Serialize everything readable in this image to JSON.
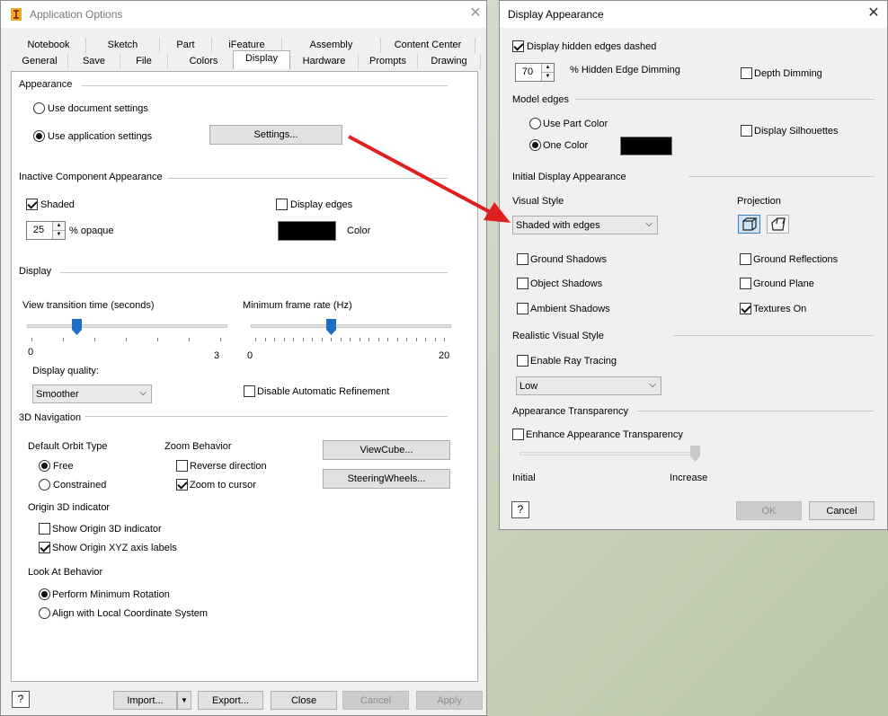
{
  "app_options": {
    "title": "Application Options",
    "tabs_row1": [
      "Notebook",
      "Sketch",
      "Part",
      "iFeature",
      "Assembly",
      "Content Center"
    ],
    "tabs_row2": [
      "General",
      "Save",
      "File",
      "Colors",
      "Display",
      "Hardware",
      "Prompts",
      "Drawing"
    ],
    "active_tab": "Display",
    "appearance": {
      "label": "Appearance",
      "use_document": "Use document settings",
      "use_application": "Use application settings",
      "settings_button": "Settings..."
    },
    "inactive": {
      "label": "Inactive Component Appearance",
      "shaded": "Shaded",
      "display_edges": "Display edges",
      "opaque_value": "25",
      "opaque_label": "% opaque",
      "color_label": "Color",
      "color_hex": "#000000"
    },
    "display": {
      "label": "Display",
      "transition_label": "View transition time (seconds)",
      "transition_min": "0",
      "transition_max": "3",
      "transition_value": 0.75,
      "frame_label": "Minimum frame rate (Hz)",
      "frame_min": "0",
      "frame_max": "20",
      "frame_value": 8,
      "quality_label": "Display quality:",
      "quality_value": "Smoother",
      "disable_refinement": "Disable Automatic Refinement"
    },
    "nav": {
      "label": "3D Navigation",
      "orbit_label": "Default Orbit Type",
      "orbit_free": "Free",
      "orbit_constrained": "Constrained",
      "zoom_label": "Zoom Behavior",
      "reverse_direction": "Reverse direction",
      "zoom_to_cursor": "Zoom to cursor",
      "viewcube_button": "ViewCube...",
      "steeringwheels_button": "SteeringWheels...",
      "origin_label": "Origin 3D indicator",
      "show_origin_3d": "Show Origin 3D indicator",
      "show_origin_xyz": "Show Origin XYZ axis labels",
      "lookat_label": "Look At Behavior",
      "perform_min_rotation": "Perform Minimum Rotation",
      "align_local": "Align with Local Coordinate System"
    },
    "footer": {
      "help": "?",
      "import": "Import...",
      "export": "Export...",
      "close": "Close",
      "cancel": "Cancel",
      "apply": "Apply"
    }
  },
  "display_appearance": {
    "title": "Display Appearance",
    "hidden_dashed": "Display hidden edges dashed",
    "dimming_value": "70",
    "dimming_label": "% Hidden Edge Dimming",
    "depth_dimming": "Depth Dimming",
    "model_edges_label": "Model edges",
    "use_part_color": "Use Part Color",
    "one_color": "One Color",
    "display_silhouettes": "Display Silhouettes",
    "edge_color_hex": "#000000",
    "initial_label": "Initial Display Appearance",
    "visual_style_label": "Visual Style",
    "visual_style_value": "Shaded with edges",
    "projection_label": "Projection",
    "ground_shadows": "Ground Shadows",
    "object_shadows": "Object Shadows",
    "ambient_shadows": "Ambient Shadows",
    "ground_reflections": "Ground Reflections",
    "ground_plane": "Ground Plane",
    "textures_on": "Textures On",
    "realistic_label": "Realistic Visual Style",
    "enable_ray_tracing": "Enable Ray Tracing",
    "ray_quality": "Low",
    "transparency_label": "Appearance Transparency",
    "enhance_transparency": "Enhance Appearance Transparency",
    "transparency_min": "Initial",
    "transparency_max": "Increase",
    "transparency_value": 1.0,
    "help": "?",
    "ok": "OK",
    "cancel": "Cancel"
  },
  "colors": {
    "arrow": "#e02020",
    "slider_thumb": "#1e6fc2"
  }
}
